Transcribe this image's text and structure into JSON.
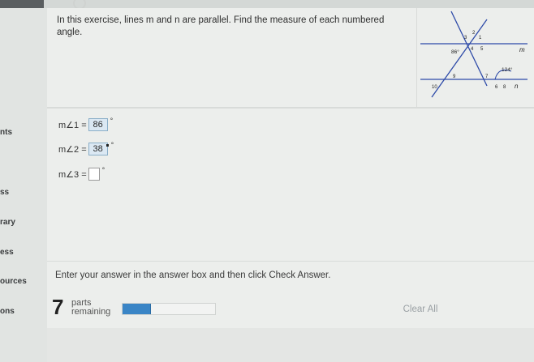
{
  "sidebar": {
    "items": [
      {
        "label": "nts"
      },
      {
        "label": "ss"
      },
      {
        "label": "rary"
      },
      {
        "label": "ess"
      },
      {
        "label": "ources"
      },
      {
        "label": "ons"
      }
    ]
  },
  "question": {
    "prompt": "In this exercise, lines m and n are parallel. Find the measure of each numbered angle."
  },
  "figure": {
    "line_m": "m",
    "line_n": "n",
    "given_angle_1": "86°",
    "given_angle_2": "124°",
    "angle_numbers": [
      "1",
      "2",
      "3",
      "4",
      "5",
      "6",
      "7",
      "8",
      "9",
      "10"
    ]
  },
  "answers": [
    {
      "label": "m∠1 =",
      "value": "86",
      "unit": "°"
    },
    {
      "label": "m∠2 =",
      "value": "38",
      "unit": "°"
    },
    {
      "label": "m∠3 =",
      "value": "",
      "unit": "°"
    }
  ],
  "footer": {
    "instructions": "Enter your answer in the answer box and then click Check Answer.",
    "parts_count": "7",
    "parts_label_1": "parts",
    "parts_label_2": "remaining",
    "progress_fraction": 0.3,
    "clear_label": "Clear All"
  },
  "colors": {
    "progress": "#3a85c6",
    "answer_highlight": "#dbe8f3"
  }
}
